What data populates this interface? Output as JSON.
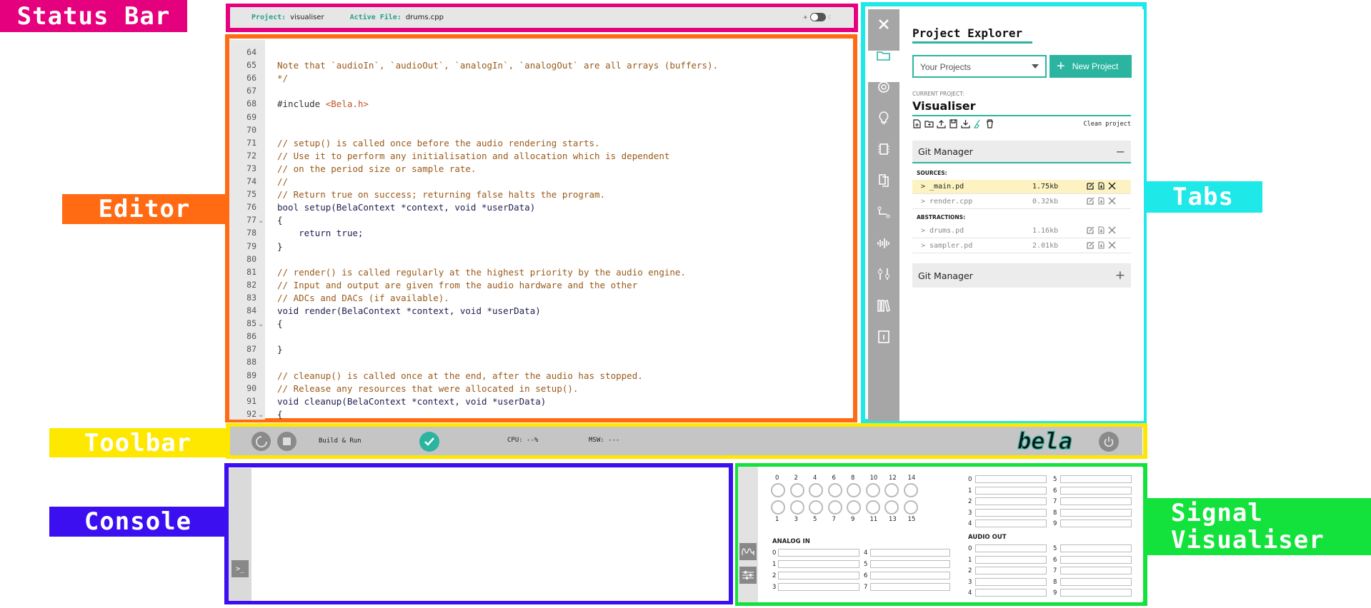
{
  "labels": {
    "status_bar": "Status Bar",
    "editor": "Editor",
    "toolbar": "Toolbar",
    "console": "Console",
    "tabs": "Tabs",
    "signal_visualiser_1": "Signal",
    "signal_visualiser_2": "Visualiser"
  },
  "colors": {
    "status_bar": "#e5007e",
    "editor": "#ff6a13",
    "toolbar": "#ffe800",
    "console": "#3b0ff0",
    "tabs": "#1fe8e8",
    "signal_visualiser": "#14e23c",
    "accent": "#2bb5a0"
  },
  "status": {
    "project_key": "Project:",
    "project_value": "visualiser",
    "file_key": "Active File:",
    "file_value": "drums.cpp"
  },
  "editor": {
    "lines": [
      {
        "n": "64",
        "fold": "",
        "text": "",
        "cls": "comment"
      },
      {
        "n": "65",
        "fold": "",
        "text": "Note that `audioIn`, `audioOut`, `analogIn`, `analogOut` are all arrays (buffers).",
        "cls": "comment"
      },
      {
        "n": "66",
        "fold": "",
        "text": "*/",
        "cls": "comment"
      },
      {
        "n": "67",
        "fold": "",
        "text": "",
        "cls": "plain"
      },
      {
        "n": "68",
        "fold": "",
        "text": "#include <Bela.h>",
        "cls": "include"
      },
      {
        "n": "69",
        "fold": "",
        "text": "",
        "cls": "plain"
      },
      {
        "n": "70",
        "fold": "",
        "text": "",
        "cls": "plain"
      },
      {
        "n": "71",
        "fold": "",
        "text": "// setup() is called once before the audio rendering starts.",
        "cls": "comment"
      },
      {
        "n": "72",
        "fold": "",
        "text": "// Use it to perform any initialisation and allocation which is dependent",
        "cls": "comment"
      },
      {
        "n": "73",
        "fold": "",
        "text": "// on the period size or sample rate.",
        "cls": "comment"
      },
      {
        "n": "74",
        "fold": "",
        "text": "//",
        "cls": "comment"
      },
      {
        "n": "75",
        "fold": "",
        "text": "// Return true on success; returning false halts the program.",
        "cls": "comment"
      },
      {
        "n": "76",
        "fold": "",
        "text": "bool setup(BelaContext *context, void *userData)",
        "cls": "code"
      },
      {
        "n": "77",
        "fold": "⌄",
        "text": "{",
        "cls": "plain"
      },
      {
        "n": "78",
        "fold": "",
        "text": "    return true;",
        "cls": "code"
      },
      {
        "n": "79",
        "fold": "",
        "text": "}",
        "cls": "plain"
      },
      {
        "n": "80",
        "fold": "",
        "text": "",
        "cls": "plain"
      },
      {
        "n": "81",
        "fold": "",
        "text": "// render() is called regularly at the highest priority by the audio engine.",
        "cls": "comment"
      },
      {
        "n": "82",
        "fold": "",
        "text": "// Input and output are given from the audio hardware and the other",
        "cls": "comment"
      },
      {
        "n": "83",
        "fold": "",
        "text": "// ADCs and DACs (if available).",
        "cls": "comment"
      },
      {
        "n": "84",
        "fold": "",
        "text": "void render(BelaContext *context, void *userData)",
        "cls": "code"
      },
      {
        "n": "85",
        "fold": "⌄",
        "text": "{",
        "cls": "plain"
      },
      {
        "n": "86",
        "fold": "",
        "text": "",
        "cls": "plain"
      },
      {
        "n": "87",
        "fold": "",
        "text": "}",
        "cls": "plain"
      },
      {
        "n": "88",
        "fold": "",
        "text": "",
        "cls": "plain"
      },
      {
        "n": "89",
        "fold": "",
        "text": "// cleanup() is called once at the end, after the audio has stopped.",
        "cls": "comment"
      },
      {
        "n": "90",
        "fold": "",
        "text": "// Release any resources that were allocated in setup().",
        "cls": "comment"
      },
      {
        "n": "91",
        "fold": "",
        "text": "void cleanup(BelaContext *context, void *userData)",
        "cls": "code"
      },
      {
        "n": "92",
        "fold": "⌄",
        "text": "{",
        "cls": "plain"
      }
    ]
  },
  "tabs": {
    "icons": [
      "close-icon",
      "folder-icon",
      "settings-icon",
      "lightbulb-icon",
      "chip-icon",
      "documents-icon",
      "pipeline-icon",
      "waveform-icon",
      "controls-icon",
      "library-icon",
      "info-icon"
    ]
  },
  "explorer": {
    "title": "Project Explorer",
    "select_value": "Your Projects",
    "new_project": "New Project",
    "current_project_label": "CURRENT PROJECT:",
    "current_project": "Visualiser",
    "clean_project": "Clean project",
    "git_manager_1": "Git Manager",
    "git_manager_2": "Git Manager",
    "sources_label": "SOURCES:",
    "abstractions_label": "ABSTRACTIONS:",
    "sources": [
      {
        "name": "> _main.pd",
        "size": "1.75kb",
        "highlight": true
      },
      {
        "name": "> render.cpp",
        "size": "0.32kb",
        "highlight": false
      }
    ],
    "abstractions": [
      {
        "name": "> drums.pd",
        "size": "1.16kb"
      },
      {
        "name": "> sampler.pd",
        "size": "2.01kb"
      }
    ]
  },
  "toolbar": {
    "build_label": "Build & Run",
    "cpu": "CPU: --%",
    "msw": "MSW: ---",
    "logo": "bela"
  },
  "visualiser": {
    "digital_top": [
      "0",
      "2",
      "4",
      "6",
      "8",
      "10",
      "12",
      "14"
    ],
    "digital_bottom": [
      "1",
      "3",
      "5",
      "7",
      "9",
      "11",
      "13",
      "15"
    ],
    "analog_in_label": "ANALOG IN",
    "analog_in_left": [
      "0",
      "1",
      "2",
      "3"
    ],
    "analog_in_right": [
      "4",
      "5",
      "6",
      "7"
    ],
    "audio_in_left": [
      "0",
      "1",
      "2",
      "3",
      "4"
    ],
    "audio_in_right": [
      "5",
      "6",
      "7",
      "8",
      "9"
    ],
    "audio_out_label": "AUDIO OUT",
    "audio_out_left": [
      "0",
      "1",
      "2",
      "3",
      "4"
    ],
    "audio_out_right": [
      "5",
      "6",
      "7",
      "8",
      "9"
    ]
  }
}
